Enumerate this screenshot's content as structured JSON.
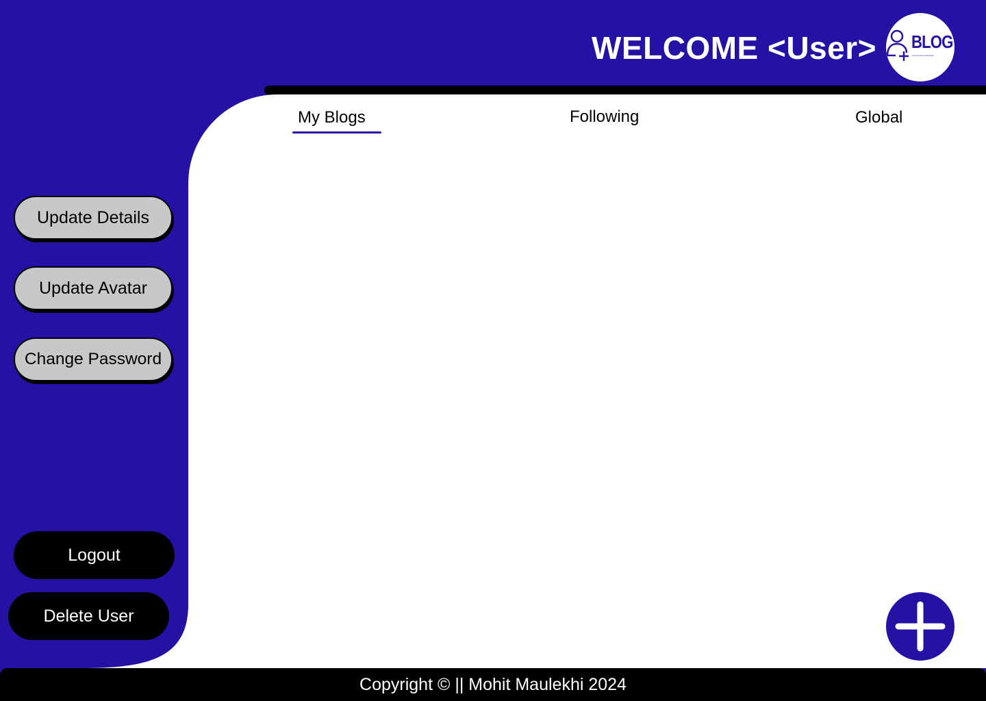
{
  "header": {
    "welcome_text": "WELCOME <User>",
    "logo_text": "BLOG",
    "logo_tagline": "Lorem Ipsum somestuff",
    "logo_icon": "add-user-icon"
  },
  "tabs": [
    {
      "label": "My Blogs",
      "active": true
    },
    {
      "label": "Following",
      "active": false
    },
    {
      "label": "Global",
      "active": false
    }
  ],
  "sidebar": {
    "update_details": "Update Details",
    "update_avatar": "Update Avatar",
    "change_password": "Change Password",
    "logout": "Logout",
    "delete_user": "Delete User"
  },
  "fab": {
    "icon": "plus-icon"
  },
  "footer": {
    "text": "Copyright © || Mohit Maulekhi 2024"
  },
  "colors": {
    "brand": "#2312a4",
    "panel": "#ffffff",
    "bar": "#000000",
    "button": "#c8c8c8"
  }
}
